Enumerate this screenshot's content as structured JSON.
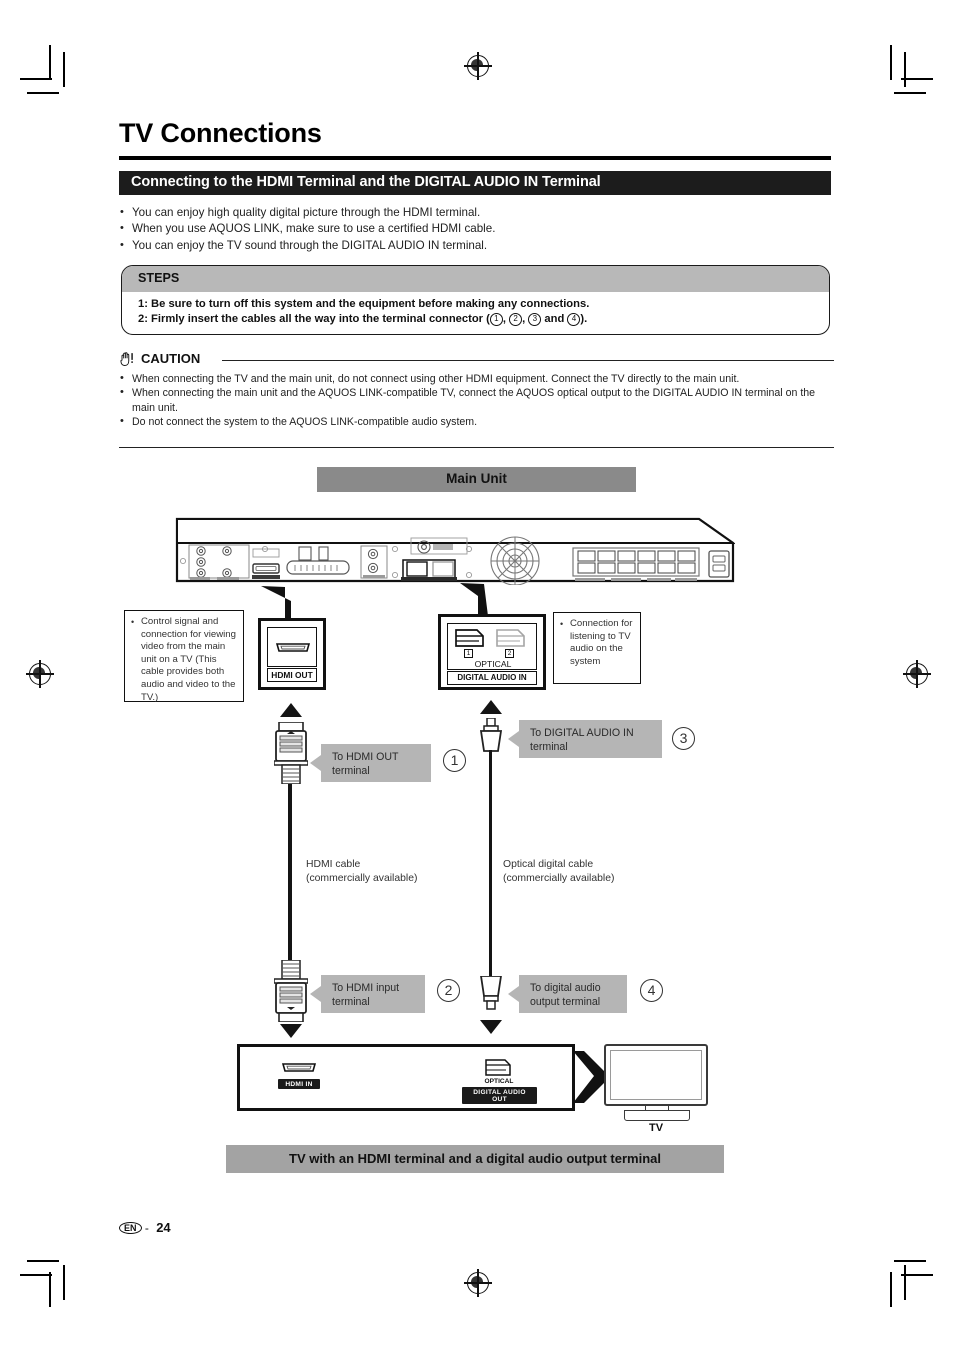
{
  "document": {
    "page_title": "TV Connections",
    "section_header": "Connecting to the HDMI Terminal and the DIGITAL AUDIO IN Terminal",
    "footer": {
      "language_badge": "EN",
      "separator": "-",
      "page_number": "24"
    }
  },
  "intro_bullets": [
    "You can enjoy high quality digital picture through the HDMI terminal.",
    "When you use AQUOS LINK, make sure to use a certified HDMI cable.",
    "You can enjoy the TV sound through the DIGITAL AUDIO IN terminal."
  ],
  "steps": {
    "heading": "STEPS",
    "items": [
      "1: Be sure to turn off this system and the equipment before making any connections.",
      "2: Firmly insert the cables all the way into the terminal connector ("
    ],
    "step2_suffix": ").",
    "step2_circled": [
      "1",
      "2",
      "3",
      "4"
    ],
    "step2_joiner": " and "
  },
  "caution": {
    "label": "CAUTION",
    "icon": "hand-warning-icon",
    "bullets": [
      "When connecting the TV and the main unit, do not connect using other HDMI equipment. Connect the TV directly to the main unit.",
      "When connecting the main unit and the AQUOS LINK-compatible TV, connect the AQUOS optical output to the DIGITAL AUDIO IN terminal on the main unit.",
      "Do not connect the system to the AQUOS LINK-compatible audio system."
    ]
  },
  "diagram": {
    "main_unit_banner": "Main Unit",
    "bottom_banner": "TV with an HDMI terminal and a digital audio output terminal",
    "tv_caption": "TV",
    "description_left": "Control signal and connection for viewing video from the main unit on a TV (This cable provides both audio and video to the TV.)",
    "description_right": "Connection for listening to TV audio on the system",
    "terminal_hdmi_out": {
      "label": "HDMI OUT"
    },
    "terminal_digital_audio_in": {
      "optical_label": "OPTICAL",
      "bottom_label": "DIGITAL AUDIO IN",
      "port_numbers": [
        "1",
        "2"
      ]
    },
    "connector_labels": [
      {
        "step": "1",
        "text": "To HDMI OUT\nterminal"
      },
      {
        "step": "3",
        "text": "To DIGITAL AUDIO IN\nterminal"
      },
      {
        "step": "2",
        "text": "To HDMI\ninput terminal"
      },
      {
        "step": "4",
        "text": "To digital audio\noutput terminal"
      }
    ],
    "label_hdmi_top": "To HDMI OUT terminal",
    "label_optical_top": "To DIGITAL AUDIO IN terminal",
    "label_hdmi_bottom": "To HDMI input terminal",
    "label_optical_bottom": "To digital audio output terminal",
    "step_numbers": {
      "one": "1",
      "two": "2",
      "three": "3",
      "four": "4"
    },
    "cable_captions": [
      "HDMI cable\n(commercially available)",
      "Optical digital cable\n(commercially available)"
    ],
    "cable_hdmi_caption_l1": "HDMI cable",
    "cable_hdmi_caption_l2": "(commercially available)",
    "cable_optical_caption_l1": "Optical digital cable",
    "cable_optical_caption_l2": "(commercially available)",
    "tv_ports": {
      "hdmi_in": "HDMI IN",
      "optical": "OPTICAL",
      "digital_audio_out": "DIGITAL AUDIO OUT"
    }
  },
  "colors": {
    "header_bar": "#1c1c1c",
    "steps_head": "#b8b8b8",
    "banner_gray": "#8a8a8a",
    "bottom_banner_gray": "#a3a3a3",
    "callout_gray": "#b5b5b5",
    "ink": "#141414"
  }
}
